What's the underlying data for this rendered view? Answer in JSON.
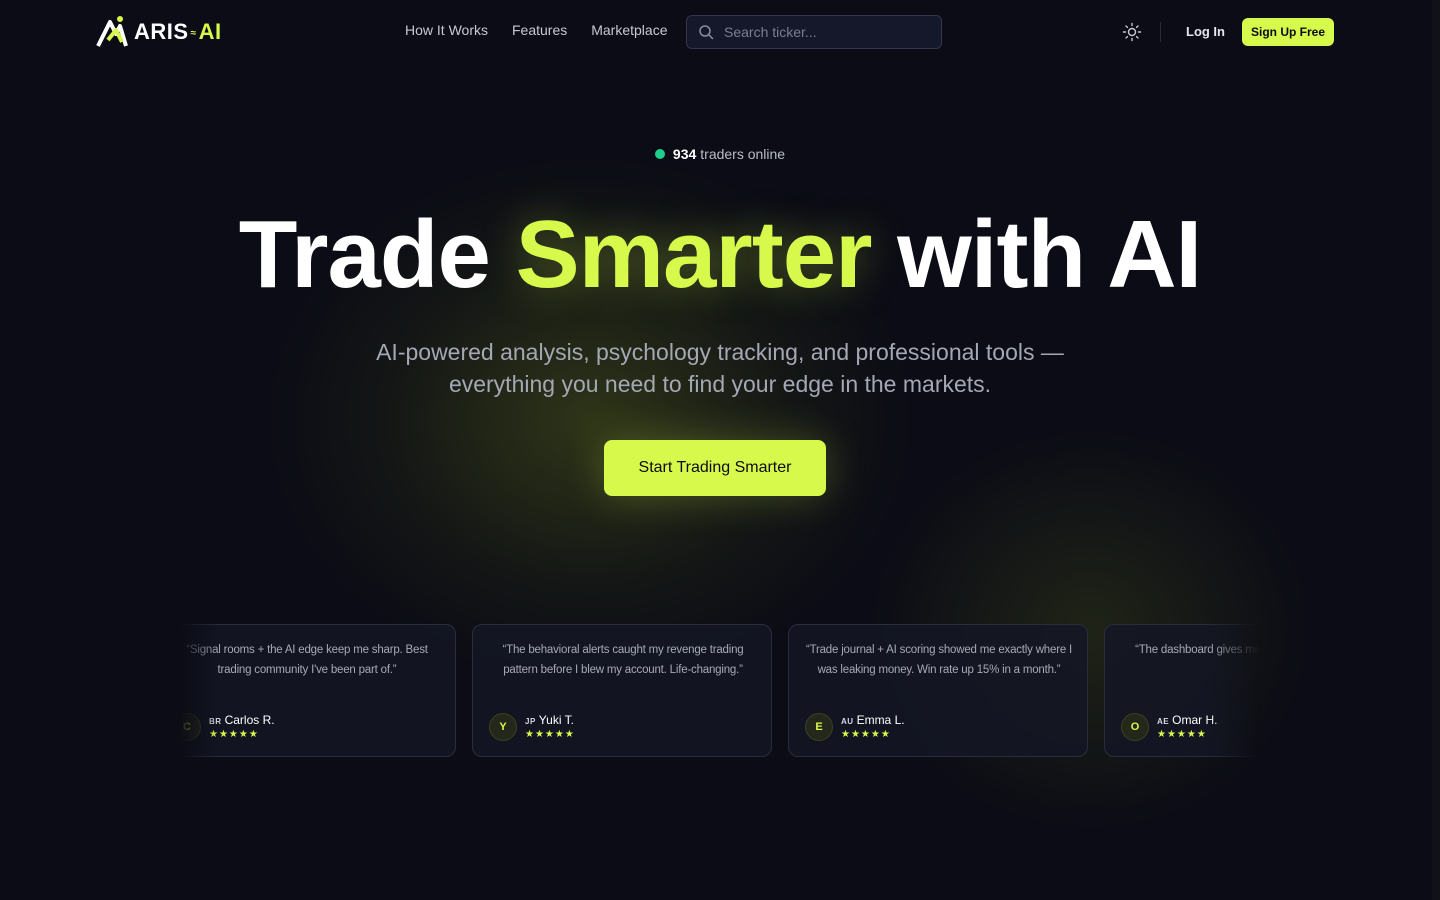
{
  "nav": {
    "logo": {
      "primary": "ARIS",
      "separator": "≈",
      "secondary": "AI"
    },
    "links": [
      "How It Works",
      "Features",
      "Marketplace"
    ],
    "search": {
      "placeholder": "Search ticker...",
      "value": ""
    },
    "theme_icon": "sun-icon",
    "login_label": "Log In",
    "signup_label": "Sign Up Free"
  },
  "hero": {
    "online_count": "934",
    "online_label": "traders online",
    "headline": {
      "part1": "Trade ",
      "highlight": "Smarter",
      "part2": " with AI"
    },
    "subtitle_line1": "AI-powered analysis, psychology tracking, and professional tools —",
    "subtitle_line2": "everything you need to find your edge in the markets.",
    "cta_label": "Start Trading Smarter"
  },
  "testimonials": [
    {
      "quote": "“Signal rooms + the AI edge keep me sharp. Best trading community I've been part of.”",
      "initial": "C",
      "country": "BR",
      "name": "Carlos R.",
      "stars": "★★★★★"
    },
    {
      "quote": "“The behavioral alerts caught my revenge trading pattern before I blew my account. Life-changing.”",
      "initial": "Y",
      "country": "JP",
      "name": "Yuki T.",
      "stars": "★★★★★"
    },
    {
      "quote": "“Trade journal + AI scoring showed me exactly where I was leaking money. Win rate up 15% in a month.”",
      "initial": "E",
      "country": "AU",
      "name": "Emma L.",
      "stars": "★★★★★"
    },
    {
      "quote": "“The dashboard gives me performance. No more",
      "initial": "O",
      "country": "AE",
      "name": "Omar H.",
      "stars": "★★★★★"
    }
  ],
  "colors": {
    "accent": "#d7f94b",
    "background": "#0b0c15",
    "online_dot": "#1fce8a"
  }
}
